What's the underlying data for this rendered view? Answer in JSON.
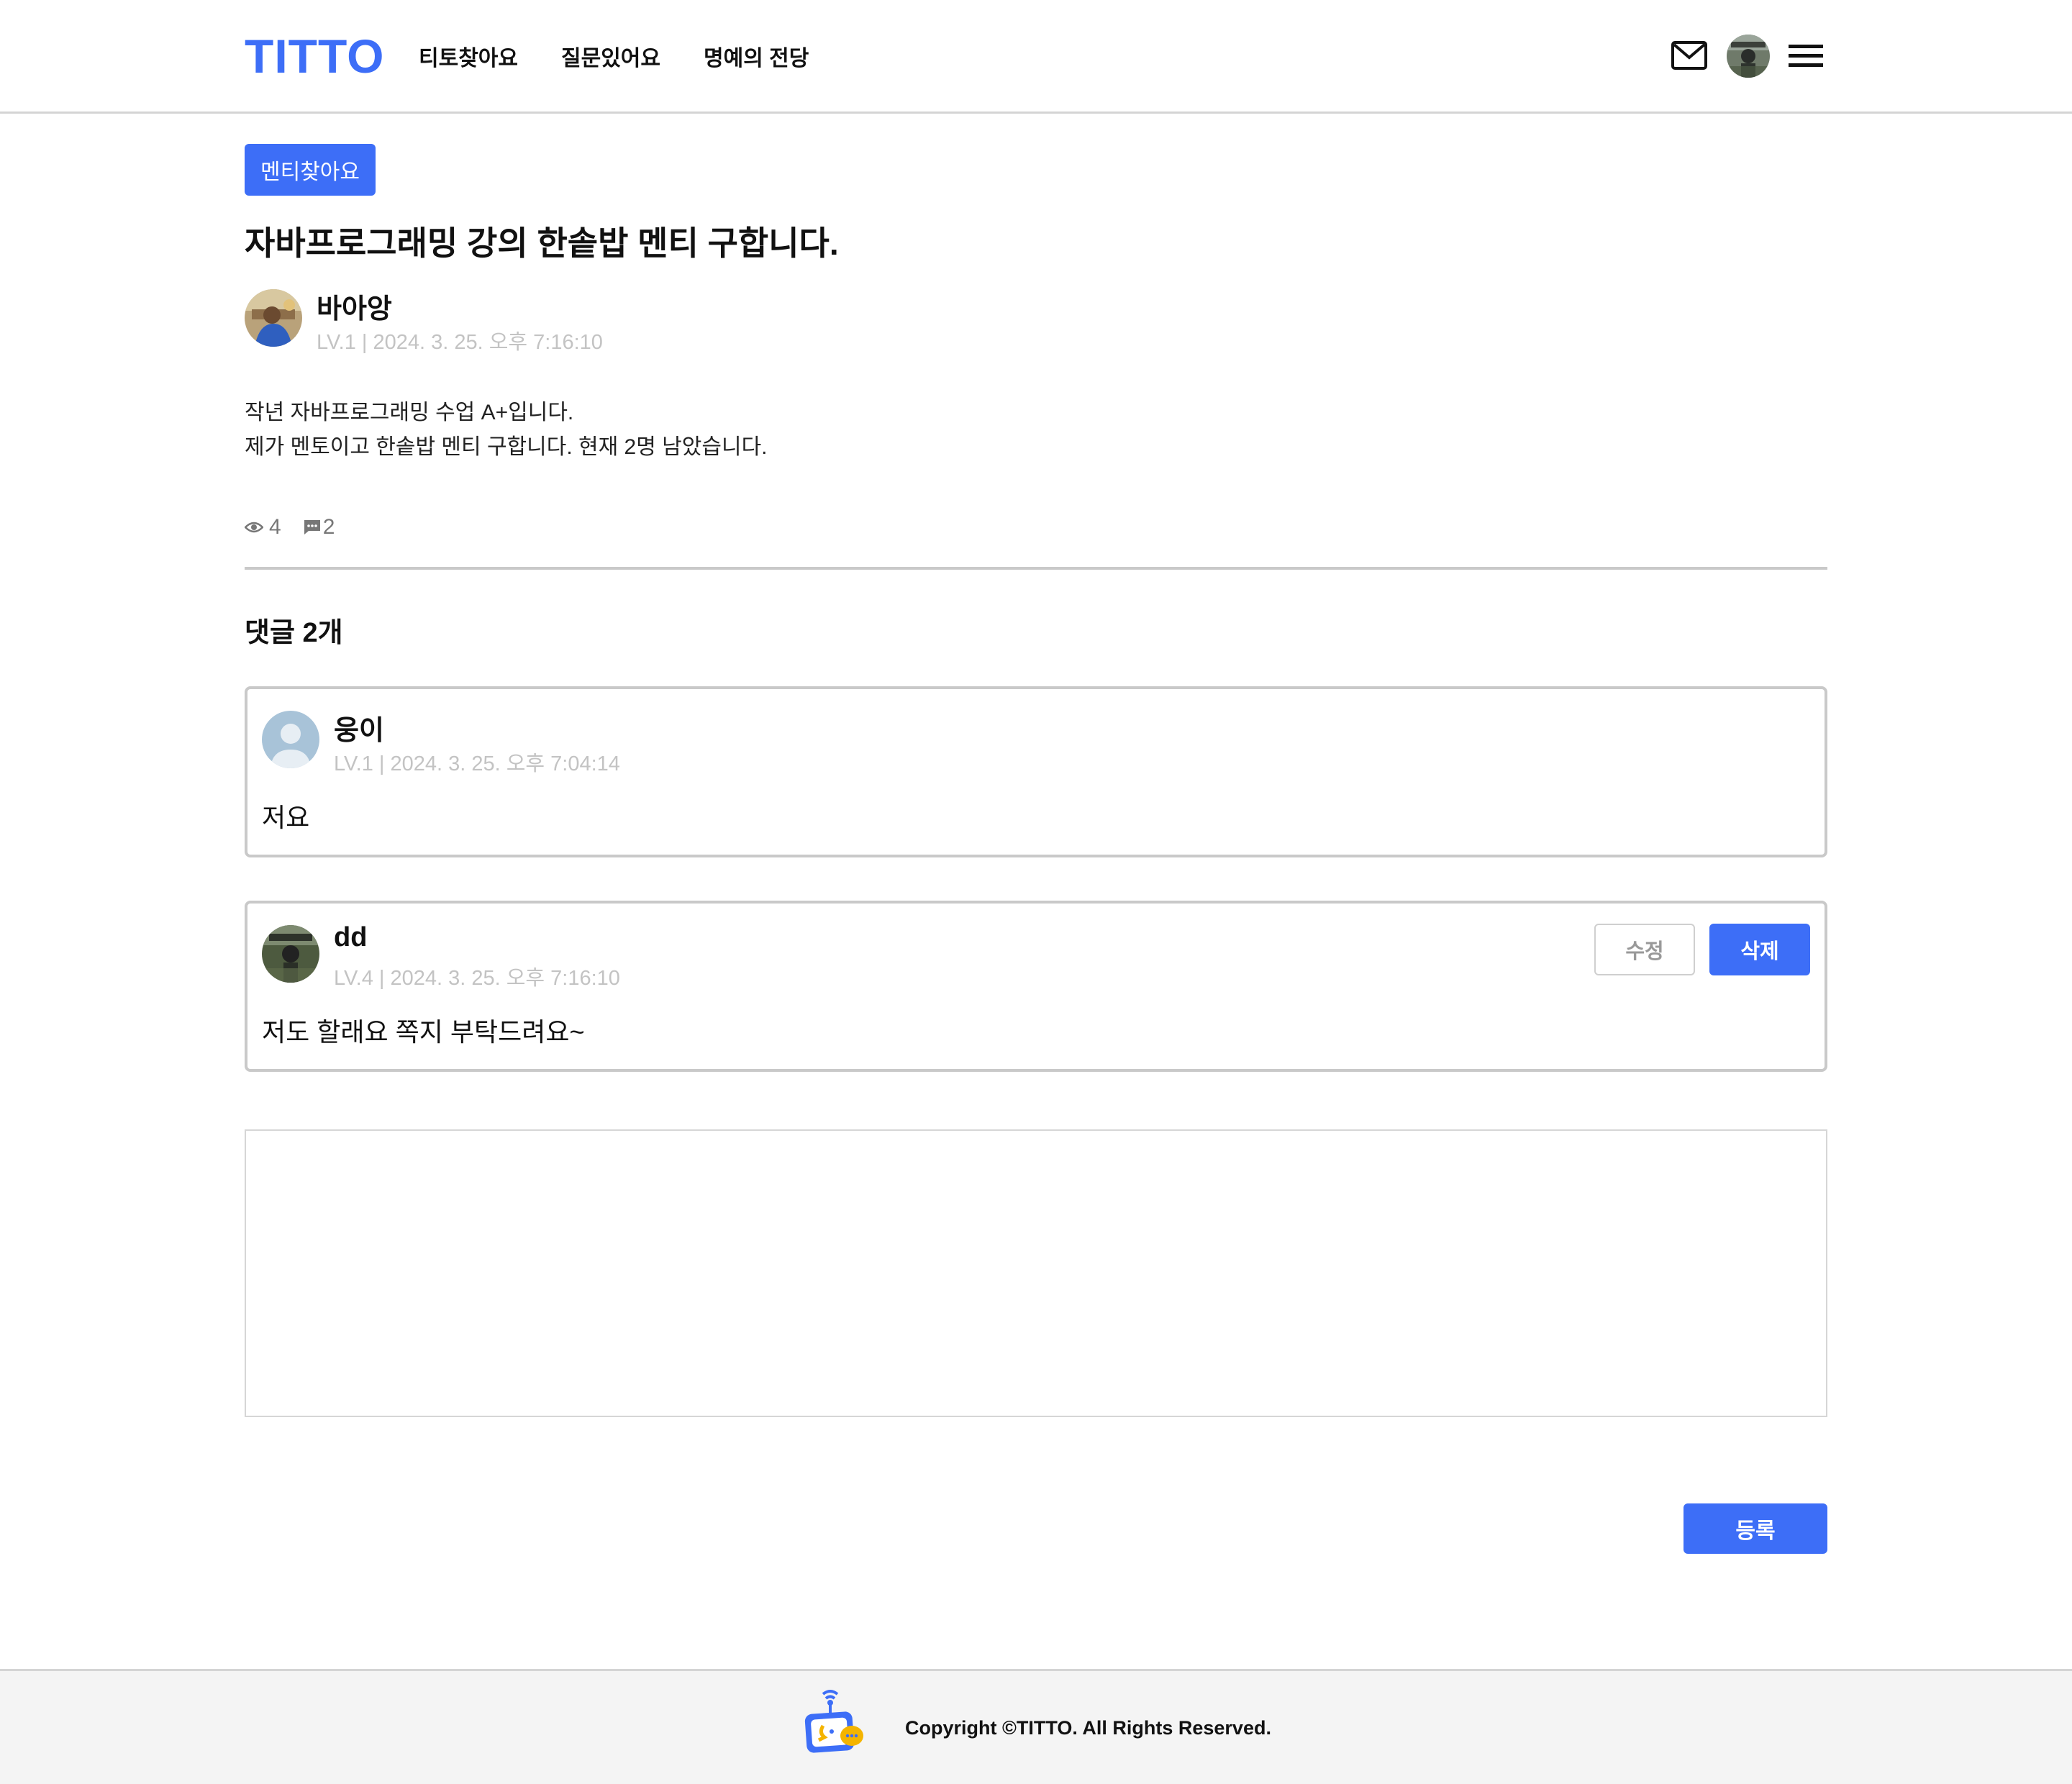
{
  "header": {
    "logo": "TITTO",
    "nav": [
      "티토찾아요",
      "질문있어요",
      "명예의 전당"
    ]
  },
  "post": {
    "category": "멘티찾아요",
    "title": "자바프로그래밍 강의 한솥밥 멘티 구합니다.",
    "author": "바아앙",
    "meta": "LV.1 | 2024. 3. 25. 오후 7:16:10",
    "body": [
      "작년 자바프로그래밍 수업 A+입니다.",
      "제가 멘토이고 한솥밥 멘티 구합니다. 현재 2명 남았습니다."
    ],
    "views": "4",
    "comment_count": "2"
  },
  "comments_section": {
    "title": "댓글 2개",
    "items": [
      {
        "author": "웅이",
        "meta": "LV.1 | 2024. 3. 25. 오후 7:04:14",
        "text": "저요"
      },
      {
        "author": "dd",
        "meta": "LV.4 | 2024. 3. 25. 오후 7:16:10",
        "text": "저도 할래요 쪽지 부탁드려요~",
        "edit_label": "수정",
        "delete_label": "삭제"
      }
    ]
  },
  "comment_form": {
    "placeholder": "",
    "submit_label": "등록"
  },
  "footer": {
    "copyright": "Copyright ©TITTO. All Rights Reserved."
  },
  "colors": {
    "accent": "#3d6ef7",
    "meta_gray": "#c3c3c3",
    "border": "#c9c9c9"
  }
}
